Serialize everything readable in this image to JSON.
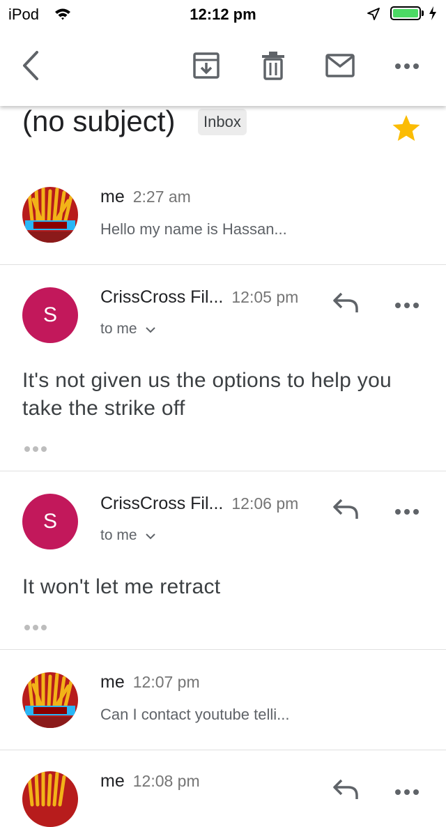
{
  "status_bar": {
    "carrier": "iPod",
    "time": "12:12 pm"
  },
  "toolbar": {
    "back_icon": "chevron-left-icon",
    "archive_icon": "archive-icon",
    "delete_icon": "trash-icon",
    "mark_unread_icon": "mail-icon",
    "more_icon": "more-horizontal-icon"
  },
  "thread": {
    "subject": "(no subject)",
    "label": "Inbox",
    "starred": true,
    "star_color": "#fbbc04"
  },
  "messages": [
    {
      "sender": "me",
      "time": "2:27 am",
      "snippet": "Hello my name is Hassan..."
    },
    {
      "sender": "CrissCross Fil...",
      "time": "12:05 pm",
      "avatar_letter": "S",
      "recipient": "to me",
      "body": "It's not given us the options to help you take the strike off"
    },
    {
      "sender": "CrissCross Fil...",
      "time": "12:06 pm",
      "avatar_letter": "S",
      "recipient": "to me",
      "body": "It won't let me retract"
    },
    {
      "sender": "me",
      "time": "12:07 pm",
      "snippet": "Can I contact youtube telli..."
    },
    {
      "sender": "me",
      "time": "12:08 pm"
    }
  ],
  "colors": {
    "avatar_s": "#c2185b",
    "battery": "#4cd964"
  }
}
